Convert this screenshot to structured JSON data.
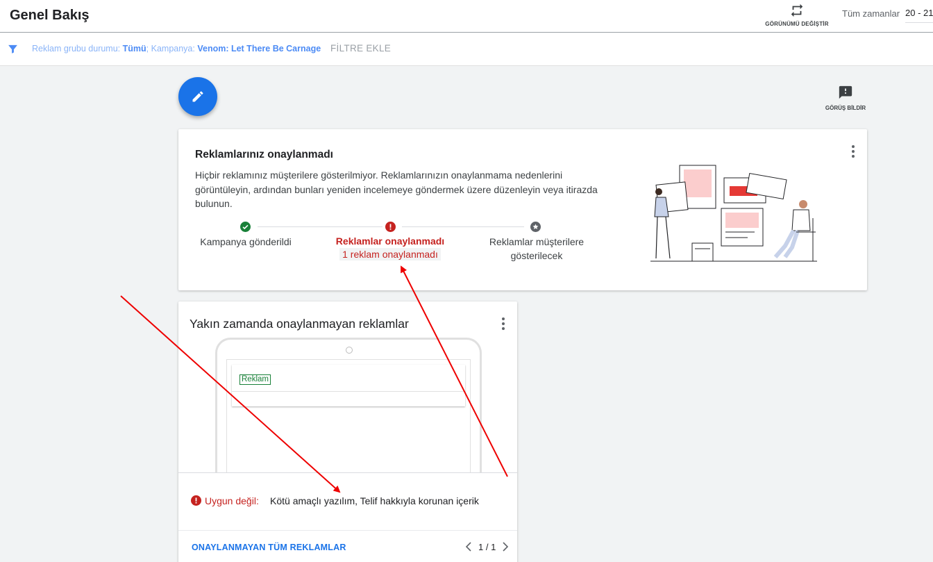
{
  "header": {
    "title": "Genel Bakış",
    "toggle_view_label": "GÖRÜNÜMÜ DEĞİŞTİR",
    "date_label": "Tüm zamanlar",
    "date_range": "20 - 21"
  },
  "filter": {
    "status_label": "Reklam grubu durumu:",
    "status_value": "Tümü",
    "campaign_label": "; Kampanya:",
    "campaign_value": "Venom: Let There Be Carnage",
    "add_filter": "FİLTRE EKLE"
  },
  "feedback": {
    "label": "GÖRÜŞ BİLDİR"
  },
  "status_card": {
    "title": "Reklamlarınız onaylanmadı",
    "description": "Hiçbir reklamınız müşterilere gösterilmiyor. Reklamlarınızın onaylanmama nedenlerini görüntüleyin, ardından bunları yeniden incelemeye göndermek üzere düzenleyin veya itirazda bulunun.",
    "steps": [
      {
        "label": "Kampanya gönderildi",
        "status": "done"
      },
      {
        "label": "Reklamlar onaylanmadı",
        "sub": "1 reklam onaylanmadı",
        "status": "error"
      },
      {
        "label": "Reklamlar müşterilere gösterilecek",
        "status": "pending"
      }
    ]
  },
  "ads_card": {
    "title": "Yakın zamanda onaylanmayan reklamlar",
    "ad_badge": "Reklam",
    "reason_label": "Uygun değil:",
    "reason_text": "Kötü amaçlı yazılım, Telif hakkıyla korunan içerik",
    "all_link": "ONAYLANMAYAN TÜM REKLAMLAR",
    "pager": "1 / 1"
  },
  "colors": {
    "accent": "#1a73e8",
    "error": "#c5221f",
    "success": "#188038",
    "annotation": "#ee0000"
  },
  "icons": [
    "swap-icon",
    "filter-icon",
    "edit-pencil-icon",
    "feedback-icon",
    "more-vert-icon",
    "check-circle-icon",
    "error-circle-icon",
    "star-circle-icon",
    "chevron-left-icon",
    "chevron-right-icon"
  ]
}
